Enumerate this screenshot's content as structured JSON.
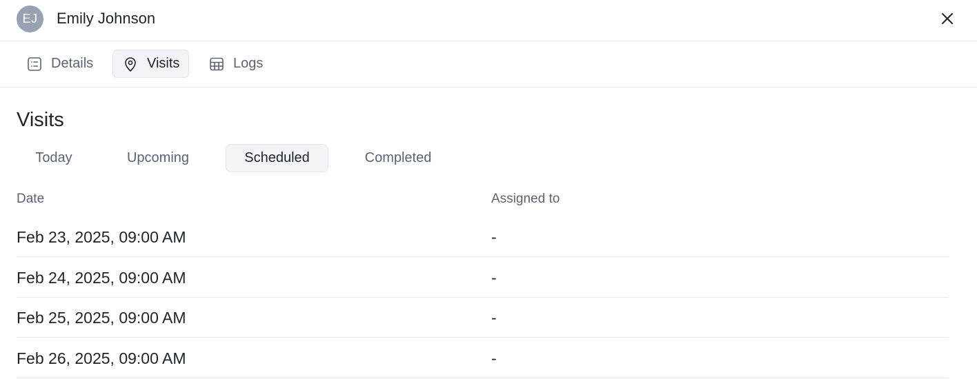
{
  "header": {
    "avatar_initials": "EJ",
    "user_name": "Emily Johnson",
    "close_icon": "close-icon"
  },
  "nav": {
    "tabs": [
      {
        "label": "Details",
        "icon": "list-icon",
        "active": false
      },
      {
        "label": "Visits",
        "icon": "location-pin-icon",
        "active": true
      },
      {
        "label": "Logs",
        "icon": "table-icon",
        "active": false
      }
    ]
  },
  "visits": {
    "title": "Visits",
    "filters": [
      {
        "label": "Today",
        "active": false
      },
      {
        "label": "Upcoming",
        "active": false
      },
      {
        "label": "Scheduled",
        "active": true
      },
      {
        "label": "Completed",
        "active": false
      }
    ],
    "columns": {
      "date": "Date",
      "assigned": "Assigned to"
    },
    "rows": [
      {
        "date": "Feb 23, 2025, 09:00 AM",
        "assigned": "-"
      },
      {
        "date": "Feb 24, 2025, 09:00 AM",
        "assigned": "-"
      },
      {
        "date": "Feb 25, 2025, 09:00 AM",
        "assigned": "-"
      },
      {
        "date": "Feb 26, 2025, 09:00 AM",
        "assigned": "-"
      }
    ]
  },
  "colors": {
    "avatar_bg": "#98a2b3",
    "active_tab_bg": "#f4f4f6",
    "border": "#e7e8ec",
    "muted_text": "#5c6370",
    "text": "#1f2328"
  }
}
